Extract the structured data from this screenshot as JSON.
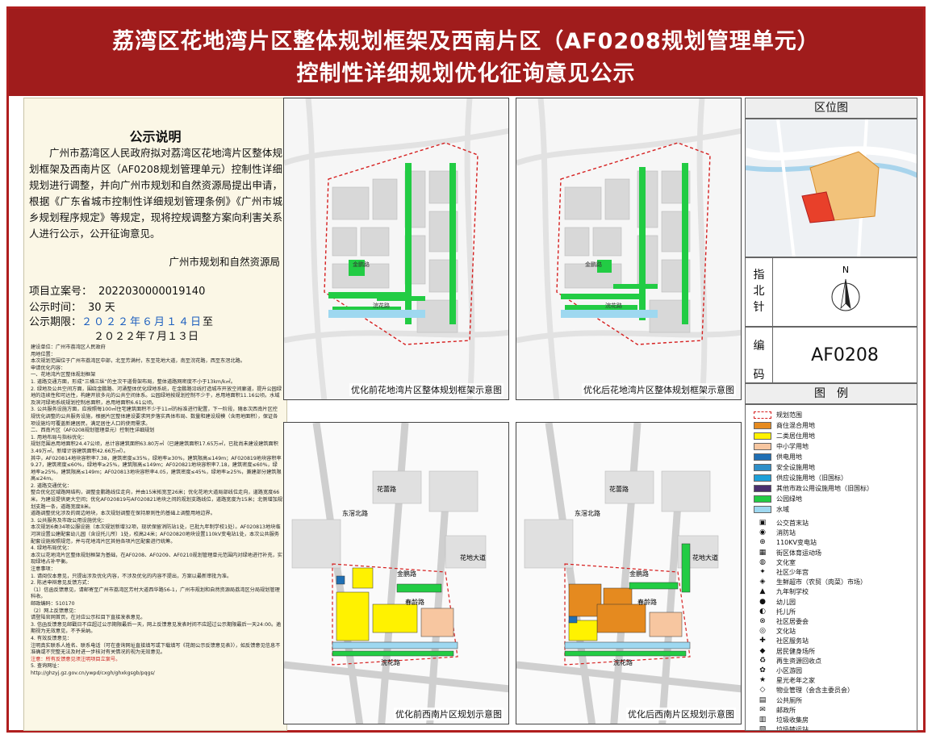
{
  "header": {
    "title_line1": "荔湾区花地湾片区整体规划框架及西南片区（AF0208规划管理单元）",
    "title_line2": "控制性详细规划优化征询意见公示"
  },
  "notice": {
    "heading": "公示说明",
    "body": "广州市荔湾区人民政府拟对荔湾区花地湾片区整体规划框架及西南片区（AF0208规划管理单元）控制性详细规划进行调整，并向广州市规划和自然资源局提出申请，根据《广东省城市控制性详细规划管理条例》《广州市城乡规划程序规定》等规定，现将控规调整方案向利害关系人进行公示，公开征询意见。",
    "signature": "广州市规划和自然资源局",
    "project_label": "项目立案号：",
    "project_no": "2022030000019140",
    "period_label": "公示时间：",
    "period_value": "30 天",
    "range_label": "公示期限：",
    "range_start": "２０２２年６月１４日",
    "range_to": "至",
    "range_end": "２０２２年７月１３日"
  },
  "details": {
    "lines": [
      "建设单位：广州市荔湾区人民政府",
      "用地位置：",
      "本次规划范围位于广州市荔湾区中部，北至芳满村，东至花地大道，南至浣花路，西至东滘北路。",
      "申请优化内容：",
      "一、花地湾片区整体规划框架",
      "1. 道路交通方面，形成“三横三纵”的主次干道骨架布局，整体道路网密度不小于13km/k㎡。",
      "2. 绿地及公共空间方面，围绕金鹏路、河涌整体优化绿地系统，在金鹏路沿线打造城市开放空间廊道，提升公园绿地的连续性和可达性，构建开放多元的公共空间体系。公园绿地按规划控制不少于，总用地面积11.16公顷。水域及滨河绿地系统规划控制总面积，总用地面积6.61公顷。",
      "3. 公共服务设施方面，应按照每100㎡住宅建筑面积不少于11㎡的标准进行配置，下一阶段，随本次西南片区控规优化调整的公共服务设施，根据片区整体建设要求同步落实具体布局、数量和建设规模（含用地面积），保证各项设施均可覆盖新建居民，满足居住人口的使用需求。",
      "二、西南片区（AF0208规划管理单元）控制性详细规划",
      "1. 用地布局与指标优化：",
      "规划范围总用地面积24.47公顷，总计容建筑面积63.80万㎡（已建建筑面积17.65万㎡，已批尚未建设建筑面积3.49万㎡，新增计容建筑面积42.66万㎡）。",
      "其中，AF020814地块容积率7.38，建筑密度≤35%，绿地率≥30%，建筑限高≤149m；AF020819地块容积率9.27，建筑密度≤60%，绿地率≥25%，建筑限高≤149m；AF020821地块容积率7.18，建筑密度≤60%，绿地率≥25%，建筑限高≤149m；AF020813地块容积率4.05，建筑密度≤45%，绿地率≥25%，兼建部分建筑限高≤24m。",
      "2. 道路交通优化：",
      "整合优化区域路网结构，调整金鹏路线位走向，并由15米拓宽至26米；优化花地大道局部线位走向，道路宽度66米，为建设提供更大空间；优化AF020819与AF020821地块之间的规划支路线位，道路宽度为15米；北侧增加规划支路一条，道路宽度8米。",
      "道路调整优化涉及的周边地块，本次规划调整在保持原则性的基础上调整用地边界。",
      "3. 公共服务及市政公用设施优化：",
      "本次规划6类34项公服设施（本次规划新增32项，现状保留消防站1处，已批九年制学校1处）。AF020813地块临河滨设置公建配套幼儿园（含设托儿所）1处，校高24米；AF020820地块设置110kV变电站1处，本次公共服务配套设施按照规范，并与花地湾片区其他各项片区配套进行统筹。",
      "4. 绿地布局优化：",
      "本次以花地湾片区整体规划框架为基础，在AF0208、AF0209、AF0210规划管理单元范围内对绿地进行补充，实现绿地占补平衡。",
      "注意事项：",
      "1. 请阅仅本意见，只提出涉及优化内容，不涉及优化的内容不提出，方案以最新审批为准。",
      "2. 陈述申辩意见反馈方式：",
      "（1）信函反馈意见，请邮寄至广州市荔湾区芳村大道西华路56-1，广州市规划和自然资源局荔湾区分局规划管理科收。",
      "邮政编码：510170",
      "（2）网上反馈意见：",
      "请登陆官网首页，在对应公示栏目下直接发表意见。",
      "3. 信函反馈意见邮戳日不应超过公示期限最后一天，网上反馈意见发表时间不应超过公示期限最后一天24:00。逾期视为无效意见，不予采纳。",
      "4. 有效反馈意见：",
      "注明真实联系人姓名、联系电话（可在查询网址直接填写或下载填写《花朗公示反馈意见表》），如反馈意见信息不准确或不完整无法及时进一步核对有关情况的视为无效意见。",
      "5. 查询网址：",
      "http://ghzyj.gz.gov.cn/ywpd/cxgh/ghxkgsgb/pqgs/"
    ],
    "note_red": "注意：所有反馈意见须注明项目立案号。"
  },
  "maps": {
    "m1_caption": "优化前花地湾片区整体规划框架示意图",
    "m2_caption": "优化后花地湾片区整体规划框架示意图",
    "m3_caption": "优化前西南片区规划示意图",
    "m4_caption": "优化后西南片区规划示意图",
    "road_jinpeng": "金鹏路",
    "road_chunling": "春龄路",
    "road_huanhua": "浣花路",
    "road_huadi": "花地大道",
    "road_dongjiao": "东滘北路",
    "road_huawei": "花蕾路"
  },
  "right": {
    "location_title": "区位图",
    "north_label_1": "指",
    "north_label_2": "北",
    "north_label_3": "针",
    "north_letter": "N",
    "code_label_1": "编",
    "code_label_2": "码",
    "code": "AF0208",
    "legend_title": "图　例",
    "legend": [
      {
        "label": "规划范围",
        "color": "#ffffff",
        "kind": "dash"
      },
      {
        "label": "商住混合用地",
        "color": "#e58a1f",
        "kind": "fill"
      },
      {
        "label": "二类居住用地",
        "color": "#fff200",
        "kind": "fill"
      },
      {
        "label": "中小学用地",
        "color": "#f7c6a0",
        "kind": "fill"
      },
      {
        "label": "供电用地",
        "color": "#1f6fb4",
        "kind": "fill"
      },
      {
        "label": "安全设施用地",
        "color": "#2f8fc8",
        "kind": "fill"
      },
      {
        "label": "供应设施用地（旧国标）",
        "color": "#1ea0d8",
        "kind": "fill"
      },
      {
        "label": "其他市政公用设施用地（旧国标）",
        "color": "#4a2f6e",
        "kind": "fill"
      },
      {
        "label": "公园绿地",
        "color": "#22cc44",
        "kind": "fill"
      },
      {
        "label": "水域",
        "color": "#9ed8f0",
        "kind": "fill"
      }
    ],
    "legend_icons": [
      {
        "label": "公交首末站",
        "icon": "▣"
      },
      {
        "label": "消防站",
        "icon": "◉"
      },
      {
        "label": "110KV变电站",
        "icon": "⊕"
      },
      {
        "label": "街区体育运动场",
        "icon": "▦"
      },
      {
        "label": "文化室",
        "icon": "◍"
      },
      {
        "label": "社区少年宫",
        "icon": "✦"
      },
      {
        "label": "生鲜超市（农贸（肉菜）市场）",
        "icon": "◈"
      },
      {
        "label": "九年制学校",
        "icon": "▲"
      },
      {
        "label": "幼儿园",
        "icon": "●"
      },
      {
        "label": "托儿所",
        "icon": "◐"
      },
      {
        "label": "社区居委会",
        "icon": "⊗"
      },
      {
        "label": "文化站",
        "icon": "◎"
      },
      {
        "label": "社区服务站",
        "icon": "✚"
      },
      {
        "label": "居民健身场所",
        "icon": "◆"
      },
      {
        "label": "再生资源回收点",
        "icon": "♻"
      },
      {
        "label": "小区游园",
        "icon": "✿"
      },
      {
        "label": "星光老年之家",
        "icon": "★"
      },
      {
        "label": "物业管理（会含主委员会）",
        "icon": "◇"
      },
      {
        "label": "公共厕所",
        "icon": "▤"
      },
      {
        "label": "邮政所",
        "icon": "✉"
      },
      {
        "label": "垃圾收集房",
        "icon": "▥"
      },
      {
        "label": "垃圾转运站",
        "icon": "▧"
      }
    ]
  }
}
